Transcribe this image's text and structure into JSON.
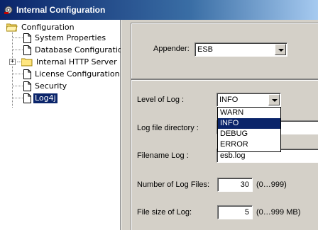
{
  "window": {
    "title": "Internal Configuration"
  },
  "tree": {
    "root": "Configuration",
    "items": [
      "System Properties",
      "Database Configuration",
      "Internal HTTP Server",
      "License Configuration",
      "Security",
      "Log4j"
    ],
    "selected": "Log4j"
  },
  "appender": {
    "label": "Appender:",
    "value": "ESB"
  },
  "log": {
    "level_label": "Level of Log :",
    "level_value": "INFO",
    "level_options": [
      "WARN",
      "INFO",
      "DEBUG",
      "ERROR"
    ],
    "dir_label": "Log file directory :",
    "dir_value": "",
    "filename_label": "Filename Log :",
    "filename_value": "esb.log",
    "num_files_label": "Number of Log Files:",
    "num_files_value": "30",
    "num_files_hint": "(0…999)",
    "file_size_label": "File size of Log:",
    "file_size_value": "5",
    "file_size_hint": "(0…999 MB)"
  }
}
